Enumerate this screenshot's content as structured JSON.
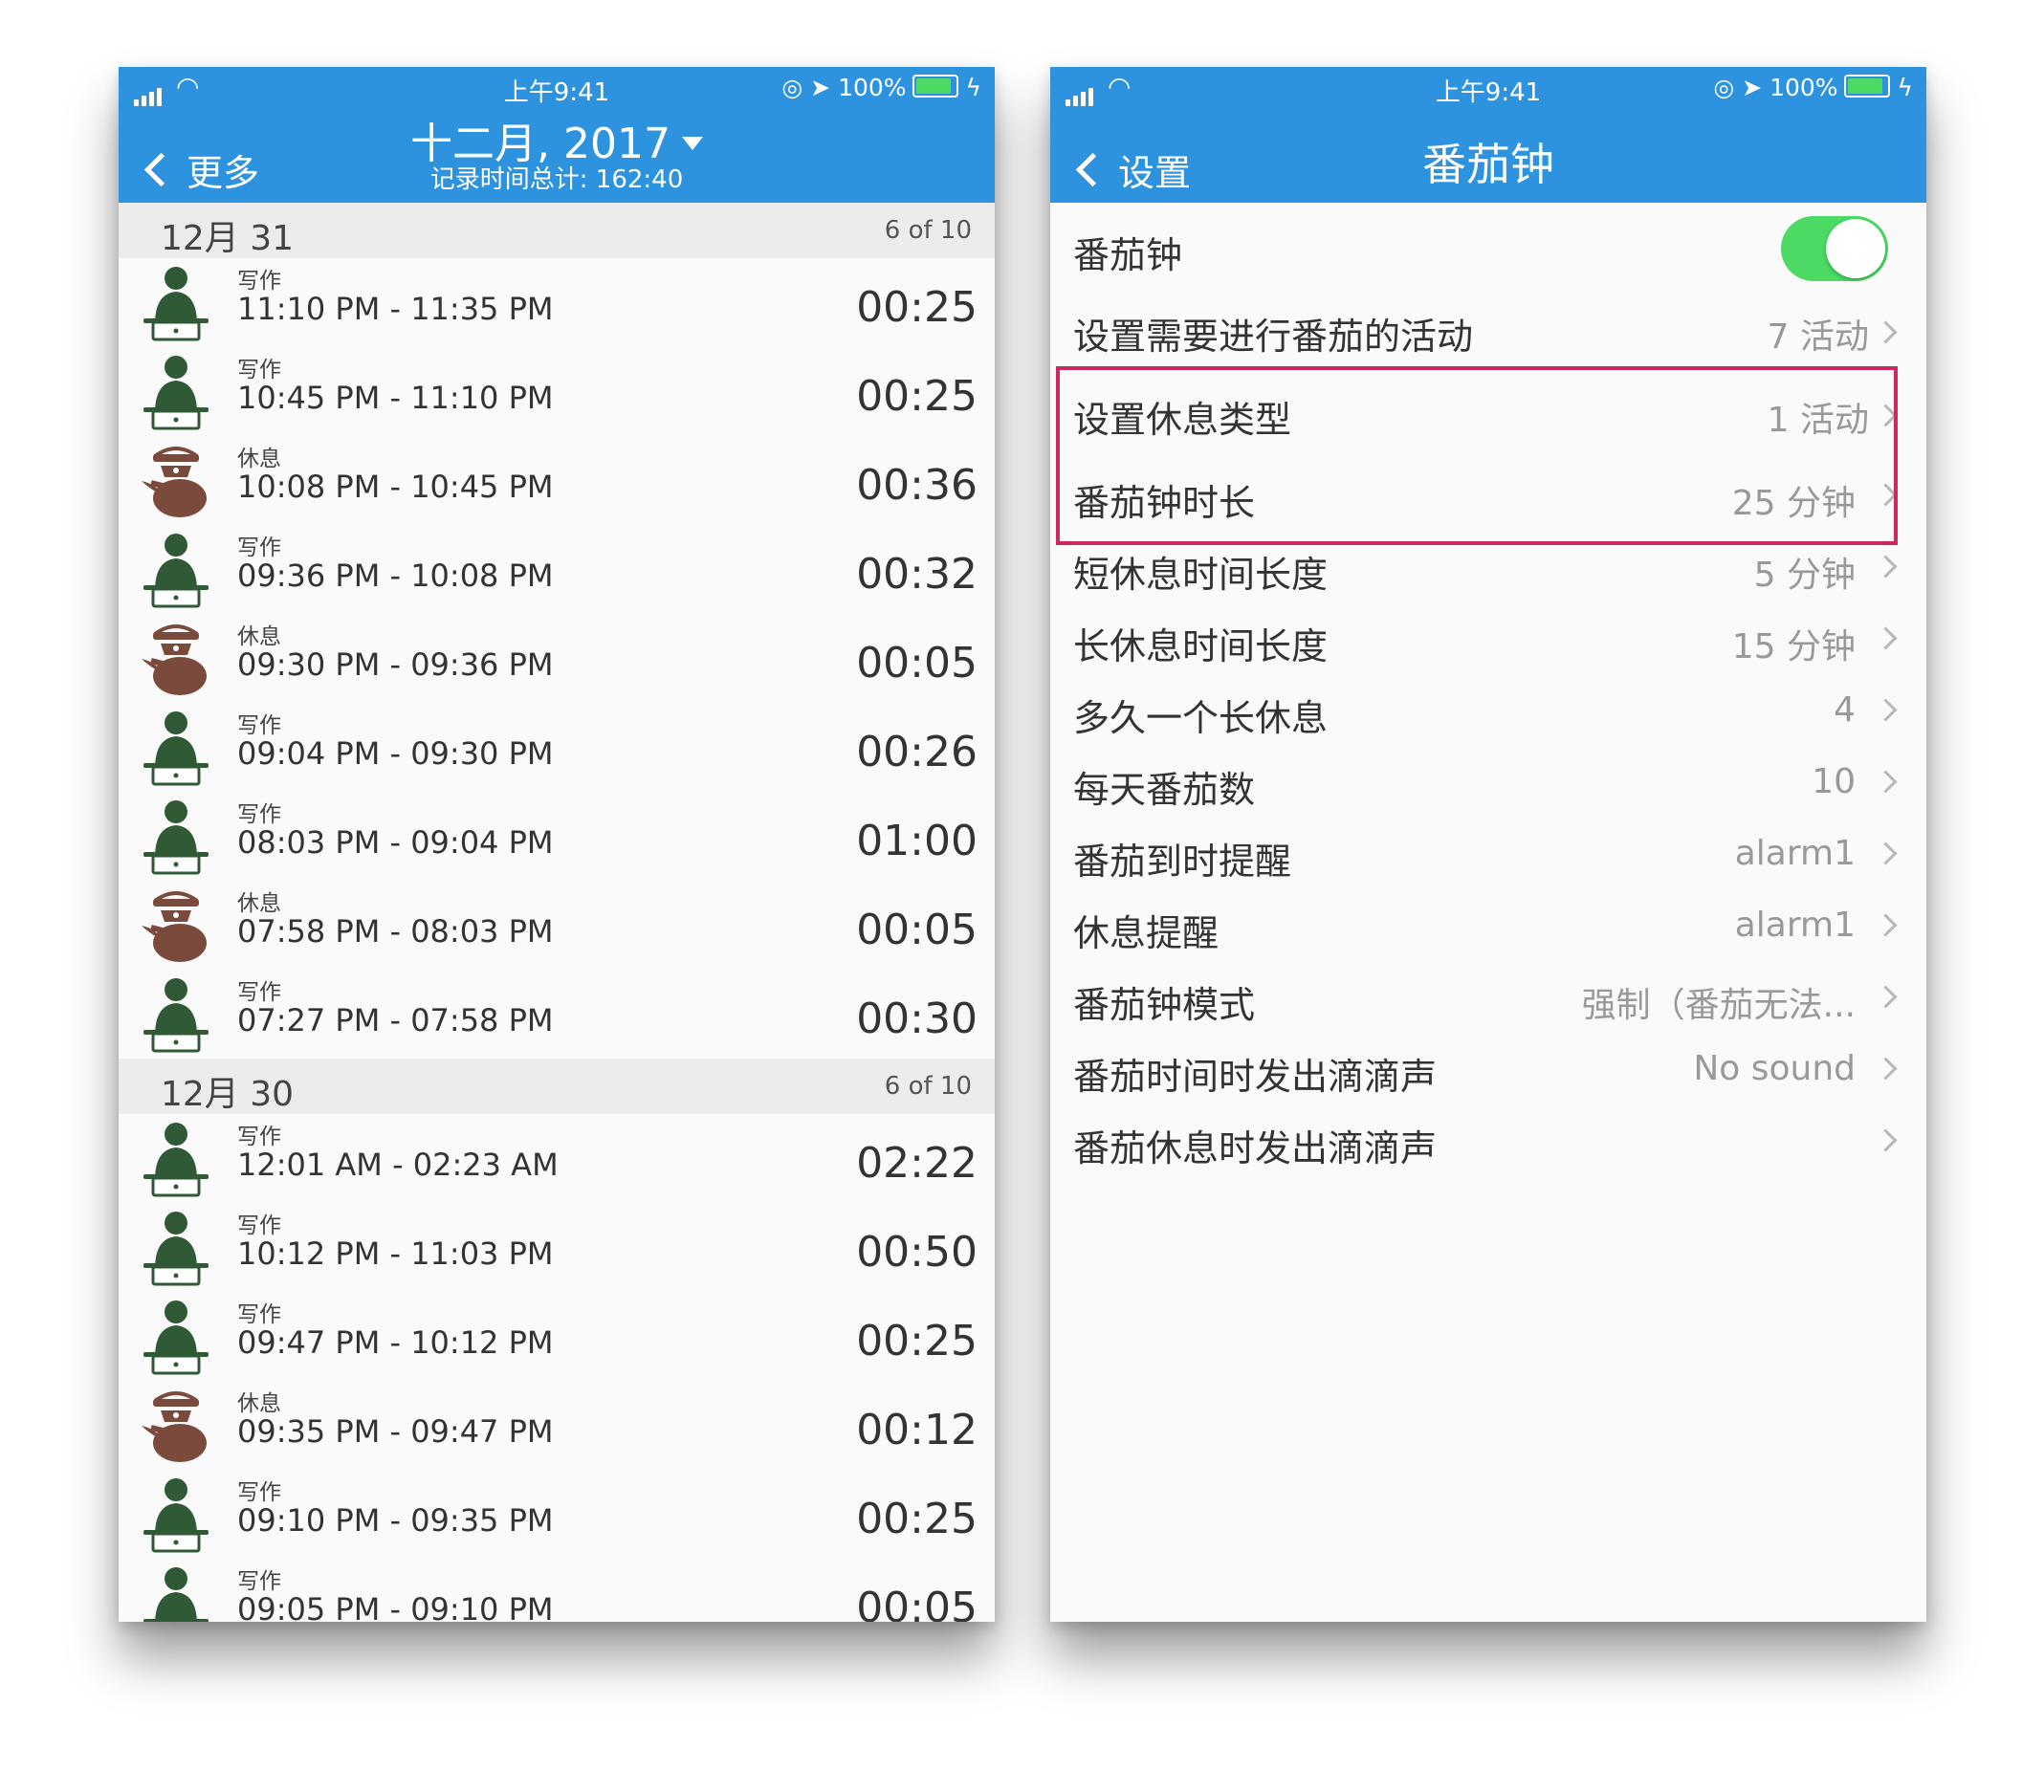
{
  "colors": {
    "nav_blue": "#2e93df",
    "toggle_green": "#4cd964",
    "work_icon": "#2f5a35",
    "rest_icon": "#7a4a3c",
    "highlight": "#cc2a5e"
  },
  "left": {
    "status": {
      "time": "上午9:41",
      "battery": "100%"
    },
    "nav": {
      "back": "更多",
      "title": "十二月, 2017",
      "subtitle": "记录时间总计: 162:40"
    },
    "sections": [
      {
        "date": "12月 31",
        "count": "6 of 10",
        "entries": [
          {
            "icon": "work-icon",
            "type": "写作",
            "time": "11:10 PM - 11:35 PM",
            "duration": "00:25"
          },
          {
            "icon": "work-icon",
            "type": "写作",
            "time": "10:45 PM - 11:10 PM",
            "duration": "00:25"
          },
          {
            "icon": "teapot-icon",
            "type": "休息",
            "time": "10:08 PM - 10:45 PM",
            "duration": "00:36"
          },
          {
            "icon": "work-icon",
            "type": "写作",
            "time": "09:36 PM - 10:08 PM",
            "duration": "00:32"
          },
          {
            "icon": "teapot-icon",
            "type": "休息",
            "time": "09:30 PM - 09:36 PM",
            "duration": "00:05"
          },
          {
            "icon": "work-icon",
            "type": "写作",
            "time": "09:04 PM - 09:30 PM",
            "duration": "00:26"
          },
          {
            "icon": "work-icon",
            "type": "写作",
            "time": "08:03 PM - 09:04 PM",
            "duration": "01:00"
          },
          {
            "icon": "teapot-icon",
            "type": "休息",
            "time": "07:58 PM - 08:03 PM",
            "duration": "00:05"
          },
          {
            "icon": "work-icon",
            "type": "写作",
            "time": "07:27 PM - 07:58 PM",
            "duration": "00:30"
          }
        ]
      },
      {
        "date": "12月 30",
        "count": "6 of 10",
        "entries": [
          {
            "icon": "work-icon",
            "type": "写作",
            "time": "12:01 AM - 02:23 AM",
            "duration": "02:22"
          },
          {
            "icon": "work-icon",
            "type": "写作",
            "time": "10:12 PM - 11:03 PM",
            "duration": "00:50"
          },
          {
            "icon": "work-icon",
            "type": "写作",
            "time": "09:47 PM - 10:12 PM",
            "duration": "00:25"
          },
          {
            "icon": "teapot-icon",
            "type": "休息",
            "time": "09:35 PM - 09:47 PM",
            "duration": "00:12"
          },
          {
            "icon": "work-icon",
            "type": "写作",
            "time": "09:10 PM - 09:35 PM",
            "duration": "00:25"
          },
          {
            "icon": "work-icon",
            "type": "写作",
            "time": "09:05 PM - 09:10 PM",
            "duration": "00:05"
          }
        ]
      }
    ]
  },
  "right": {
    "status": {
      "time": "上午9:41",
      "battery": "100%"
    },
    "nav": {
      "back": "设置",
      "title": "番茄钟"
    },
    "toggle_row": {
      "label": "番茄钟",
      "enabled": true
    },
    "rows": [
      {
        "label": "设置需要进行番茄的活动",
        "value": "7 活动"
      },
      {
        "label": "设置休息类型",
        "value": "1 活动"
      },
      {
        "label": "番茄钟时长",
        "value": "25 分钟"
      },
      {
        "label": "短休息时间长度",
        "value": "5 分钟"
      },
      {
        "label": "长休息时间长度",
        "value": "15 分钟"
      },
      {
        "label": "多久一个长休息",
        "value": "4"
      },
      {
        "label": "每天番茄数",
        "value": "10"
      },
      {
        "label": "番茄到时提醒",
        "value": "alarm1"
      },
      {
        "label": "休息提醒",
        "value": "alarm1"
      },
      {
        "label": "番茄钟模式",
        "value": "强制（番茄无法..."
      },
      {
        "label": "番茄时间时发出滴滴声",
        "value": "No sound"
      },
      {
        "label": "番茄休息时发出滴滴声",
        "value": ""
      }
    ]
  }
}
